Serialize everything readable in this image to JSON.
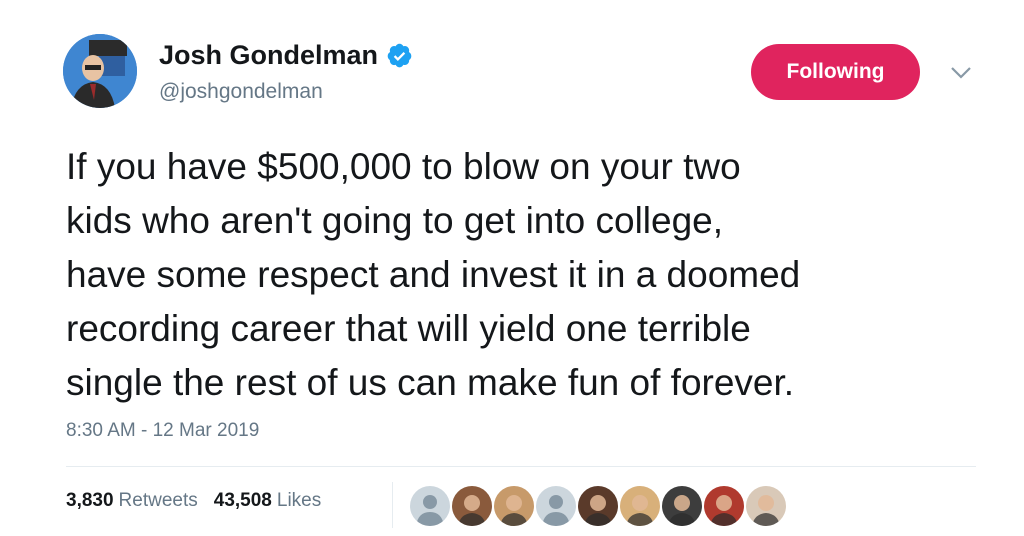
{
  "author": {
    "name": "Josh Gondelman",
    "handle": "@joshgondelman",
    "verified": true,
    "avatar_icon": "profile-photo"
  },
  "follow_button": {
    "label": "Following",
    "color": "#e0245e"
  },
  "caret_icon": "chevron-down-icon",
  "tweet": {
    "lines": [
      "If you have $500,000 to blow on your two",
      "kids who aren't going to get into college,",
      "have some respect and invest it in a doomed",
      "recording career that will yield one terrible",
      "single the rest of us can make fun of forever."
    ],
    "timestamp": "8:30 AM - 12 Mar 2019"
  },
  "stats": {
    "retweets_count": "3,830",
    "retweets_label": "Retweets",
    "likes_count": "43,508",
    "likes_label": "Likes"
  },
  "likers": [
    {
      "kind": "default",
      "color": "#8899a6"
    },
    {
      "kind": "photo",
      "color": "#8a5a3c"
    },
    {
      "kind": "photo",
      "color": "#c79a6a"
    },
    {
      "kind": "default",
      "color": "#8899a6"
    },
    {
      "kind": "photo",
      "color": "#5a3a2a"
    },
    {
      "kind": "photo",
      "color": "#d8b07a"
    },
    {
      "kind": "photo",
      "color": "#3d3d3d"
    },
    {
      "kind": "photo",
      "color": "#b03a2e"
    },
    {
      "kind": "photo",
      "color": "#d9c9b8"
    }
  ],
  "colors": {
    "text": "#14171a",
    "muted": "#657786",
    "verified": "#1da1f2"
  }
}
